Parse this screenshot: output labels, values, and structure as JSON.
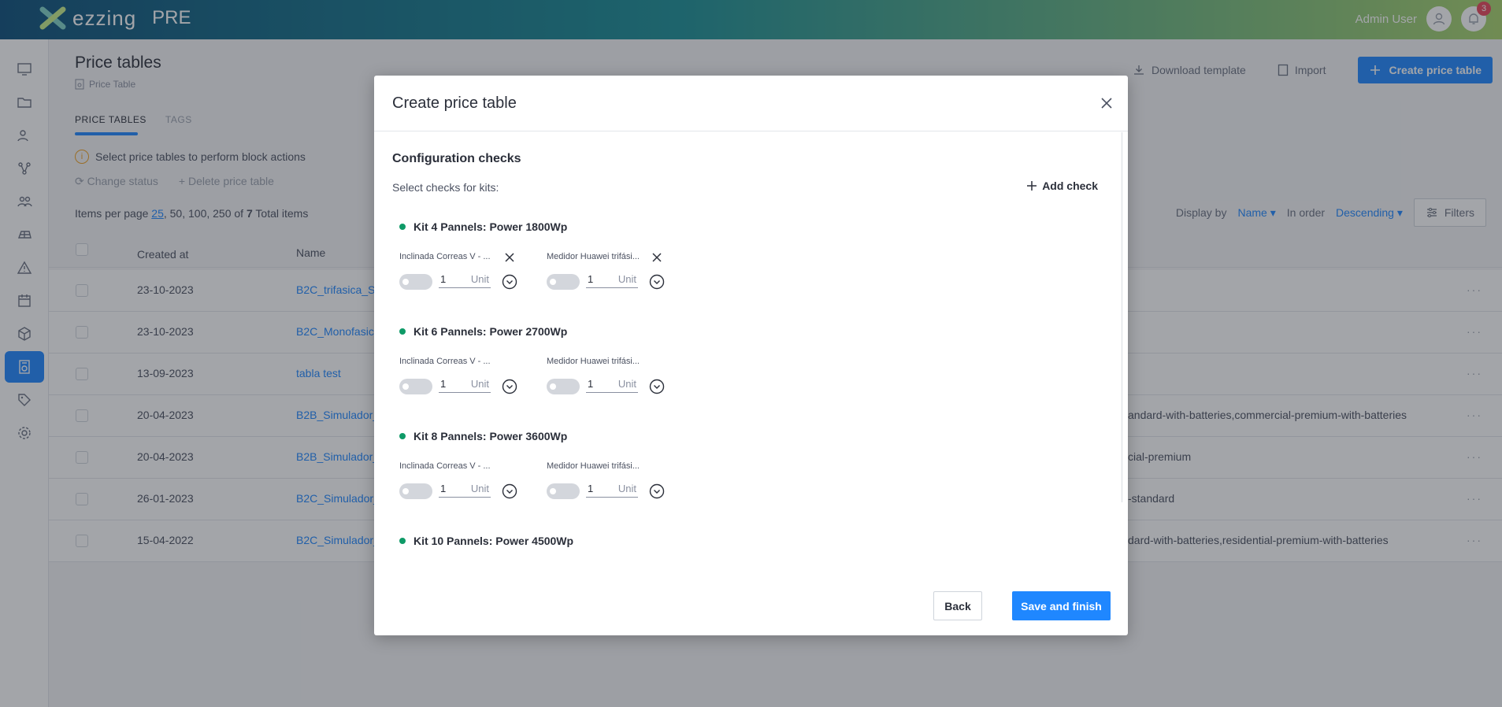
{
  "app": {
    "logo_text": "ezzing",
    "env": "PRE",
    "user_name": "Admin User",
    "notifications": "3"
  },
  "page": {
    "title": "Price tables",
    "breadcrumb": "Price Table",
    "tabs": [
      "PRICE TABLES",
      "TAGS"
    ],
    "download_template": "Download template",
    "import": "Import",
    "create": "Create price table",
    "info": "Select price tables to perform block actions",
    "change_status": "Change status",
    "delete": "Delete price table",
    "pager": {
      "label": "Items per page",
      "selected": "25",
      "rest": ", 50, 100, 250",
      "of": "of",
      "total": "7",
      "total_label": "Total items"
    },
    "display_by_label": "Display by",
    "display_by_value": "Name",
    "order_label": "In order",
    "order_value": "Descending",
    "filters": "Filters",
    "columns": {
      "created_at": "Created at",
      "name": "Name"
    },
    "rows": [
      {
        "date": "23-10-2023",
        "name": "B2C_trifasica_S",
        "tags": ""
      },
      {
        "date": "23-10-2023",
        "name": "B2C_Monofasic",
        "tags": ""
      },
      {
        "date": "13-09-2023",
        "name": "tabla test",
        "tags": ""
      },
      {
        "date": "20-04-2023",
        "name": "B2B_Simulador_",
        "tags": "andard-with-batteries,commercial-premium-with-batteries"
      },
      {
        "date": "20-04-2023",
        "name": "B2B_Simulador_",
        "tags": "cial-premium"
      },
      {
        "date": "26-01-2023",
        "name": "B2C_Simulador_",
        "tags": "-standard"
      },
      {
        "date": "15-04-2022",
        "name": "B2C_Simulador_",
        "tags": "dard-with-batteries,residential-premium-with-batteries"
      }
    ],
    "row_menu": "···"
  },
  "modal": {
    "title": "Create price table",
    "section_title": "Configuration checks",
    "section_subtitle": "Select checks for kits:",
    "add_check": "Add check",
    "kits": [
      {
        "title": "Kit 4 Pannels: Power 1800Wp",
        "checks": [
          {
            "label": "Inclinada Correas V - ...",
            "qty": "1",
            "unit": "Unit"
          },
          {
            "label": "Medidor Huawei trifási...",
            "qty": "1",
            "unit": "Unit"
          }
        ]
      },
      {
        "title": "Kit 6 Pannels: Power 2700Wp",
        "checks": [
          {
            "label": "Inclinada Correas V - ...",
            "qty": "1",
            "unit": "Unit"
          },
          {
            "label": "Medidor Huawei trifási...",
            "qty": "1",
            "unit": "Unit"
          }
        ]
      },
      {
        "title": "Kit 8 Pannels: Power 3600Wp",
        "checks": [
          {
            "label": "Inclinada Correas V - ...",
            "qty": "1",
            "unit": "Unit"
          },
          {
            "label": "Medidor Huawei trifási...",
            "qty": "1",
            "unit": "Unit"
          }
        ]
      },
      {
        "title": "Kit 10 Pannels: Power 4500Wp",
        "checks": []
      }
    ],
    "back": "Back",
    "save": "Save and finish"
  },
  "colors": {
    "accent": "#1f87ff",
    "kit_dot": "#0e9a67",
    "badge": "#e8455b"
  },
  "icons": [
    "logo-icon",
    "user-icon",
    "bell-icon",
    "close-icon",
    "plus-icon",
    "chevron-down-icon",
    "download-icon",
    "import-icon",
    "filter-icon",
    "info-icon",
    "refresh-icon",
    "price-table-icon"
  ]
}
